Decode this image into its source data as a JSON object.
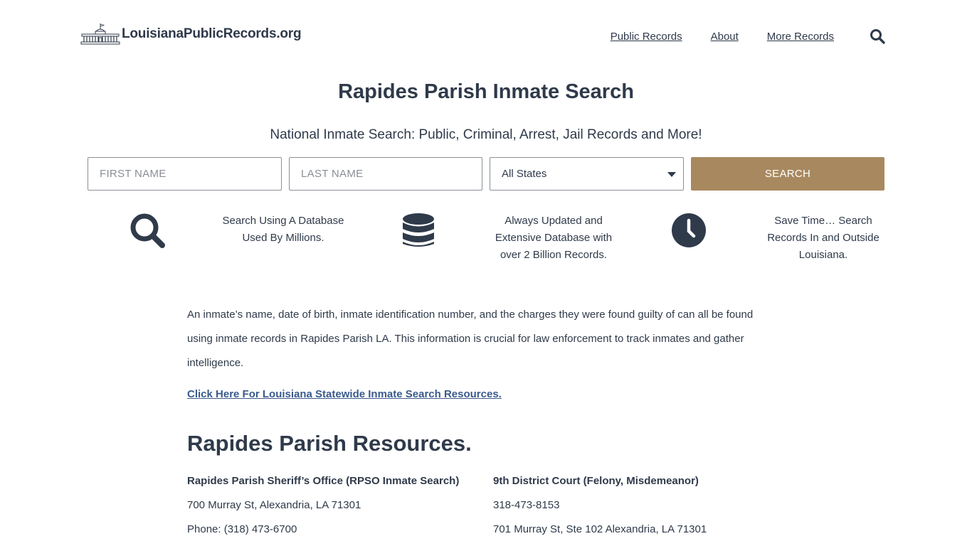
{
  "header": {
    "logo_text": "LouisianaPublicRecords.org",
    "nav": [
      "Public Records",
      "About",
      "More Records"
    ]
  },
  "hero": {
    "title": "Rapides Parish Inmate Search",
    "subtitle": "National Inmate Search: Public, Criminal, Arrest, Jail Records and More!"
  },
  "search": {
    "first_placeholder": "FIRST NAME",
    "last_placeholder": "LAST NAME",
    "state_selected": "All States",
    "button_label": "SEARCH",
    "button_color": "#a8895f"
  },
  "features": [
    {
      "icon": "search-icon",
      "text": "Search Using A Database Used By Millions."
    },
    {
      "icon": "database-icon",
      "text": "Always Updated and Extensive Database with over 2 Billion Records."
    },
    {
      "icon": "clock-icon",
      "text": "Save Time… Search Records In and Outside Louisiana."
    }
  ],
  "content": {
    "intro": "An inmate’s name, date of birth, inmate identification number, and the charges they were found guilty of can all be found using inmate records in Rapides Parish LA. This information is crucial for law enforcement to track inmates and gather intelligence.",
    "statewide_link": "Click Here For Louisiana Statewide Inmate Search Resources.",
    "resources_title": "Rapides Parish Resources.",
    "resources": [
      {
        "name": "Rapides Parish Sheriff’s Office (RPSO Inmate Search)",
        "lines": [
          "700 Murray St, Alexandria, LA 71301",
          "Phone: (318) 473-6700"
        ]
      },
      {
        "name": "9th District Court (Felony, Misdemeanor)",
        "lines": [
          "318-473-8153",
          "701 Murray St, Ste 102 Alexandria, LA 71301"
        ]
      }
    ]
  },
  "colors": {
    "text": "#2f3a4a",
    "link": "#3a5a8c",
    "accent": "#a8895f"
  }
}
